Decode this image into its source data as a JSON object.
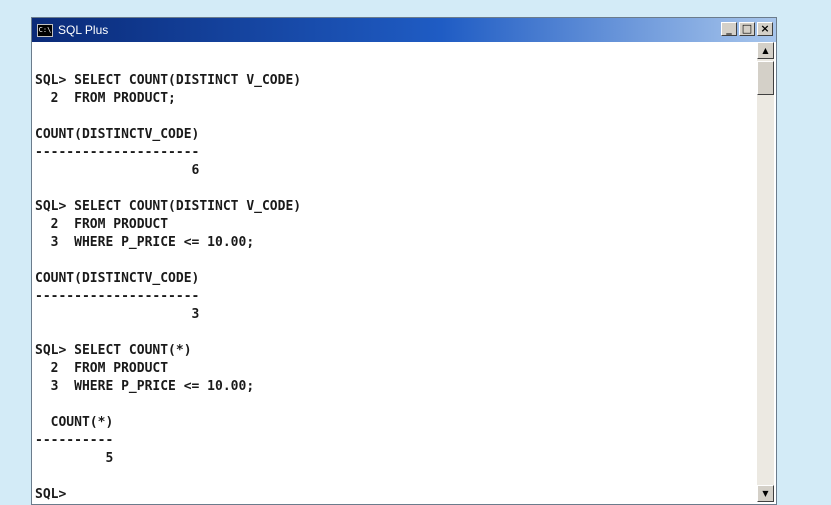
{
  "window": {
    "title": "SQL Plus",
    "icon": "cmd-icon",
    "icon_text": "C:\\",
    "minimize_glyph": "_",
    "maximize_glyph": "□",
    "close_glyph": "×"
  },
  "scrollbar": {
    "up_glyph": "▲",
    "down_glyph": "▼"
  },
  "console": {
    "lines": [
      "",
      "SQL> SELECT COUNT(DISTINCT V_CODE)",
      "  2  FROM PRODUCT;",
      "",
      "COUNT(DISTINCTV_CODE)",
      "---------------------",
      "                    6",
      "",
      "SQL> SELECT COUNT(DISTINCT V_CODE)",
      "  2  FROM PRODUCT",
      "  3  WHERE P_PRICE <= 10.00;",
      "",
      "COUNT(DISTINCTV_CODE)",
      "---------------------",
      "                    3",
      "",
      "SQL> SELECT COUNT(*)",
      "  2  FROM PRODUCT",
      "  3  WHERE P_PRICE <= 10.00;",
      "",
      "  COUNT(*)",
      "----------",
      "         5",
      "",
      "SQL>"
    ]
  }
}
